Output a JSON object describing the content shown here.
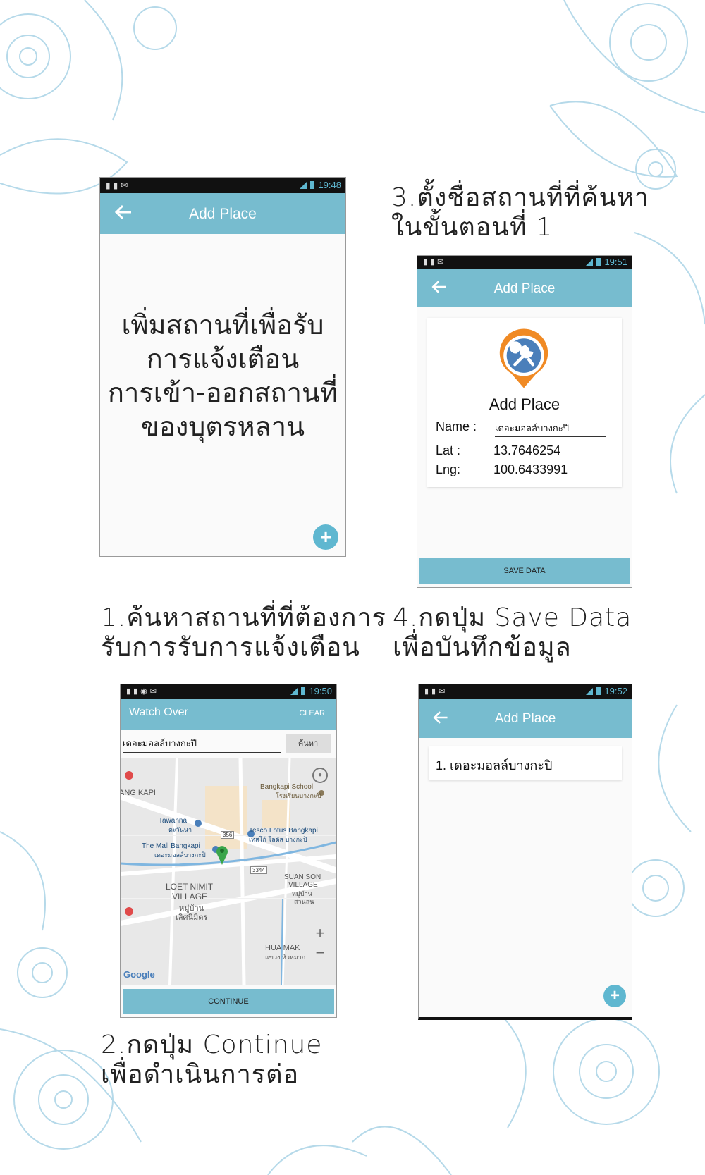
{
  "colors": {
    "accent": "#77bccf",
    "accent_dark": "#5fb7d0",
    "marker": "#3aa54a"
  },
  "captions": {
    "step1": "1.ค้นหาสถานที่ที่ต้องการ\n  รับการรับการแจ้งเตือน",
    "step2": "2.กดปุ่ม Continue\n  เพื่อดำเนินการต่อ",
    "step3": "3.ตั้งชื่อสถานที่ที่ค้นหา\n  ในขั้นตอนที่ 1",
    "step4": "4.กดปุ่ม Save Data\n  เพื่อบันทึกข้อมูล"
  },
  "screen_intro": {
    "time": "19:48",
    "title": "Add Place",
    "message_lines": [
      "เพิ่มสถานที่เพื่อรับ",
      "การแจ้งเตือน",
      "การเข้า-ออกสถานที่",
      "ของบุตรหลาน"
    ],
    "fab": "+"
  },
  "screen_search": {
    "time": "19:50",
    "title": "Watch Over",
    "clear_label": "CLEAR",
    "search_value": "เดอะมอลล์บางกะปิ",
    "search_button": "ค้นหา",
    "continue_label": "CONTINUE",
    "map_labels": [
      "Bangkapi School",
      "โรงเรียนบางกะปิ",
      "Tawanna",
      "ตะวันนา",
      "Tesco Lotus Bangkapi",
      "เทสโก้ โลตัส บางกะปิ",
      "The Mall Bangkapi",
      "เดอะมอลล์บางกะปิ",
      "LOET NIMIT",
      "VILLAGE",
      "หมู่บ้าน",
      "เลิศนิมิตร",
      "SUAN SON",
      "VILLAGE",
      "หมู่บ้าน",
      "สวนสน",
      "HUA MAK",
      "แขวง หัวหมาก",
      "ANG KAPI",
      "356",
      "3344"
    ],
    "google": "Google",
    "zoom_in": "+",
    "zoom_out": "−"
  },
  "screen_form": {
    "time": "19:51",
    "title": "Add Place",
    "heading": "Add Place",
    "name_label": "Name :",
    "name_value": "เดอะมอลล์บางกะปิ",
    "lat_label": "Lat :",
    "lat_value": "13.7646254",
    "lng_label": "Lng:",
    "lng_value": "100.6433991",
    "save_label": "SAVE DATA"
  },
  "screen_list": {
    "time": "19:52",
    "title": "Add Place",
    "items": [
      "1.  เดอะมอลล์บางกะปิ"
    ],
    "fab": "+"
  }
}
